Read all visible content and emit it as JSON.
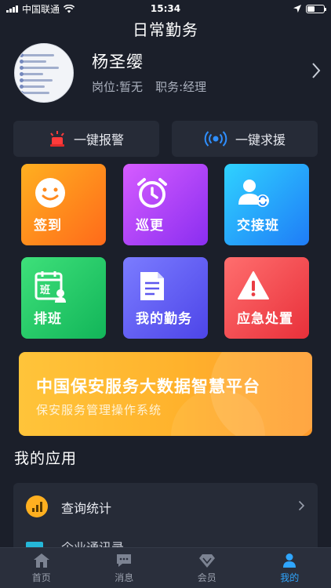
{
  "status_bar": {
    "carrier": "中国联通",
    "time": "15:34"
  },
  "header": {
    "title": "日常勤务"
  },
  "profile": {
    "name": "杨圣缨",
    "position": "岗位:暂无",
    "duty": "职务:经理"
  },
  "quick_actions": {
    "alarm_label": "一键报警",
    "help_label": "一键求援"
  },
  "tiles": [
    {
      "label": "签到",
      "icon": "smile-icon"
    },
    {
      "label": "巡更",
      "icon": "alarm-clock-icon"
    },
    {
      "label": "交接班",
      "icon": "user-swap-icon"
    },
    {
      "label": "排班",
      "icon": "schedule-icon"
    },
    {
      "label": "我的勤务",
      "icon": "document-icon"
    },
    {
      "label": "应急处置",
      "icon": "warning-icon"
    }
  ],
  "banner": {
    "title": "中国保安服务大数据智慧平台",
    "subtitle": "保安服务管理操作系统"
  },
  "my_apps": {
    "title": "我的应用",
    "items": [
      {
        "label": "查询统计",
        "icon": "bar-chart-icon"
      },
      {
        "label": "企业通讯录",
        "icon": "contacts-icon"
      }
    ]
  },
  "tabbar": [
    {
      "label": "首页",
      "icon": "home-icon",
      "active": false
    },
    {
      "label": "消息",
      "icon": "message-icon",
      "active": false
    },
    {
      "label": "会员",
      "icon": "diamond-icon",
      "active": false
    },
    {
      "label": "我的",
      "icon": "person-icon",
      "active": true
    }
  ],
  "colors": {
    "background": "#1b1f2a",
    "card": "#262b37",
    "accent": "#2fa6ff",
    "banner": "#ffb22c"
  }
}
